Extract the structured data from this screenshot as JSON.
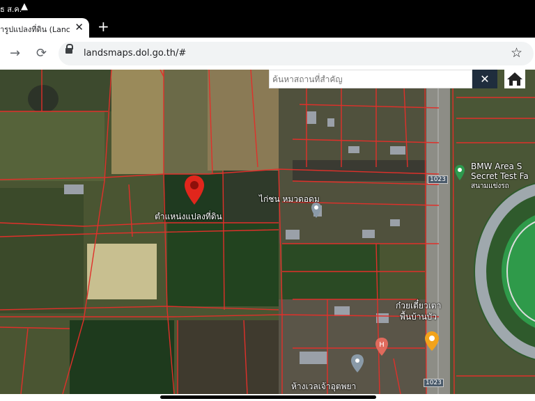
{
  "status_bar": {
    "text": "ธ ส.ค.",
    "warning_icon": "warning-icon"
  },
  "browser": {
    "tab_title": "ารูปแปลงที่ดิน (Lanc",
    "new_tab_icon": "plus-icon",
    "url": "landsmaps.dol.go.th/#"
  },
  "map": {
    "search_placeholder": "ค้นหาสถานที่สำคัญ",
    "clear_label": "✕",
    "parcel_label": "ตำแหน่งแปลงที่ดิน",
    "labels": {
      "village": "ไก่ชน หมวดอดม",
      "poi_bmw_1": "BMW Area S",
      "poi_bmw_2": "Secret Test Fa",
      "poi_bmw_3": "สนามแข่งรถ",
      "road_1": "1023",
      "road_2": "1023",
      "poi_temple_1": "ก๋วยเตี๋ยวเตา",
      "poi_temple_2": "พื้นบ้านบัว",
      "poi_bottom": "ห้างเวลเจ้าอุตพยา"
    },
    "colors": {
      "parcel_border": "#e0302a",
      "pin": "#e1261c"
    }
  }
}
